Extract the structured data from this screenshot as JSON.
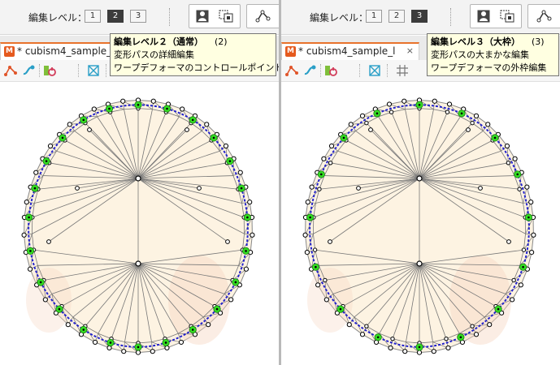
{
  "toolbar": {
    "edit_level_label": "編集レベル：",
    "levels": [
      "1",
      "2",
      "3"
    ]
  },
  "left": {
    "active_level": 1,
    "tab_title": "* cubism4_sample_",
    "tooltip": {
      "title": "編集レベル２（通常）",
      "shortcut": "(2)",
      "line1": "変形パスの詳細編集",
      "line2": "ワープデフォーマのコントロールポイント編集"
    }
  },
  "right": {
    "active_level": 2,
    "tab_title": "* cubism4_sample_l",
    "tab_close": "×",
    "tooltip": {
      "title": "編集レベル３（大枠）",
      "shortcut": "(3)",
      "line1": "変形パスの大まかな編集",
      "line2": "ワープデフォーマの外枠編集"
    }
  },
  "colors": {
    "mesh_fill": "#fdf3e2",
    "path": "#2222cc",
    "control_point": "#33dd22",
    "tab_accent": "#e8722c",
    "tooltip_bg": "#ffffe1"
  },
  "icons": {
    "person": "person-icon",
    "warp": "warp-deformer-icon",
    "path_tool": "path-tool-icon"
  }
}
